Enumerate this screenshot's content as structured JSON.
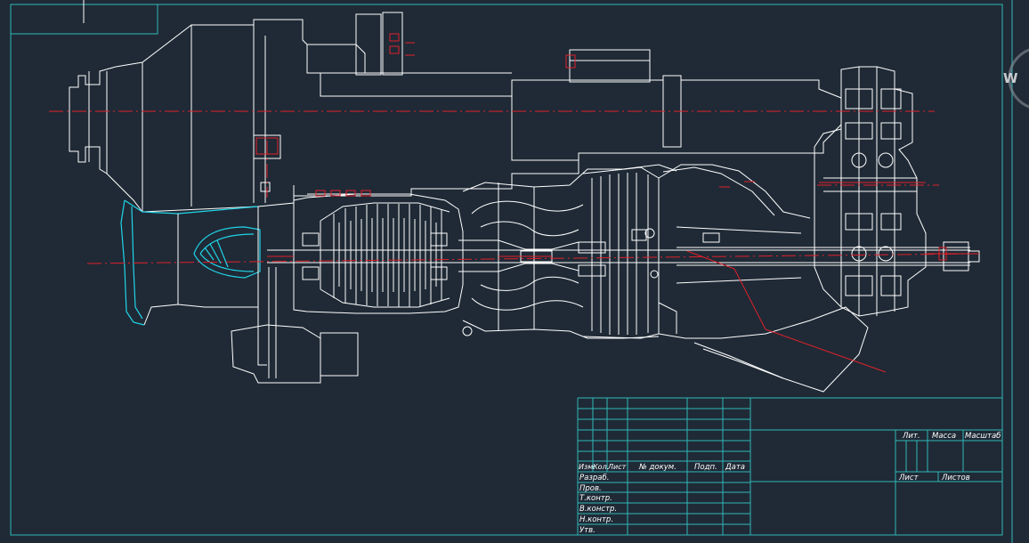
{
  "title_block": {
    "headers": {
      "izm": "Изм.",
      "kol": "Кол.",
      "list": "Лист",
      "doc_no": "№ докум.",
      "sign": "Подп.",
      "date": "Дата"
    },
    "rows": [
      "Разраб.",
      "Пров.",
      "Т.контр.",
      "В.констр.",
      "Н.контр.",
      "Утв."
    ],
    "lit": "Лит.",
    "massa": "Масса",
    "masshtab": "Масштаб",
    "sheet": "Лист",
    "sheets": "Листов"
  },
  "watermark": {
    "letter": "W"
  },
  "colors": {
    "background": "#1f2a36",
    "outline": "#ffffff",
    "frame": "#2fb8b8",
    "axis": "#e0202a",
    "highlight": "#21d4e8"
  }
}
